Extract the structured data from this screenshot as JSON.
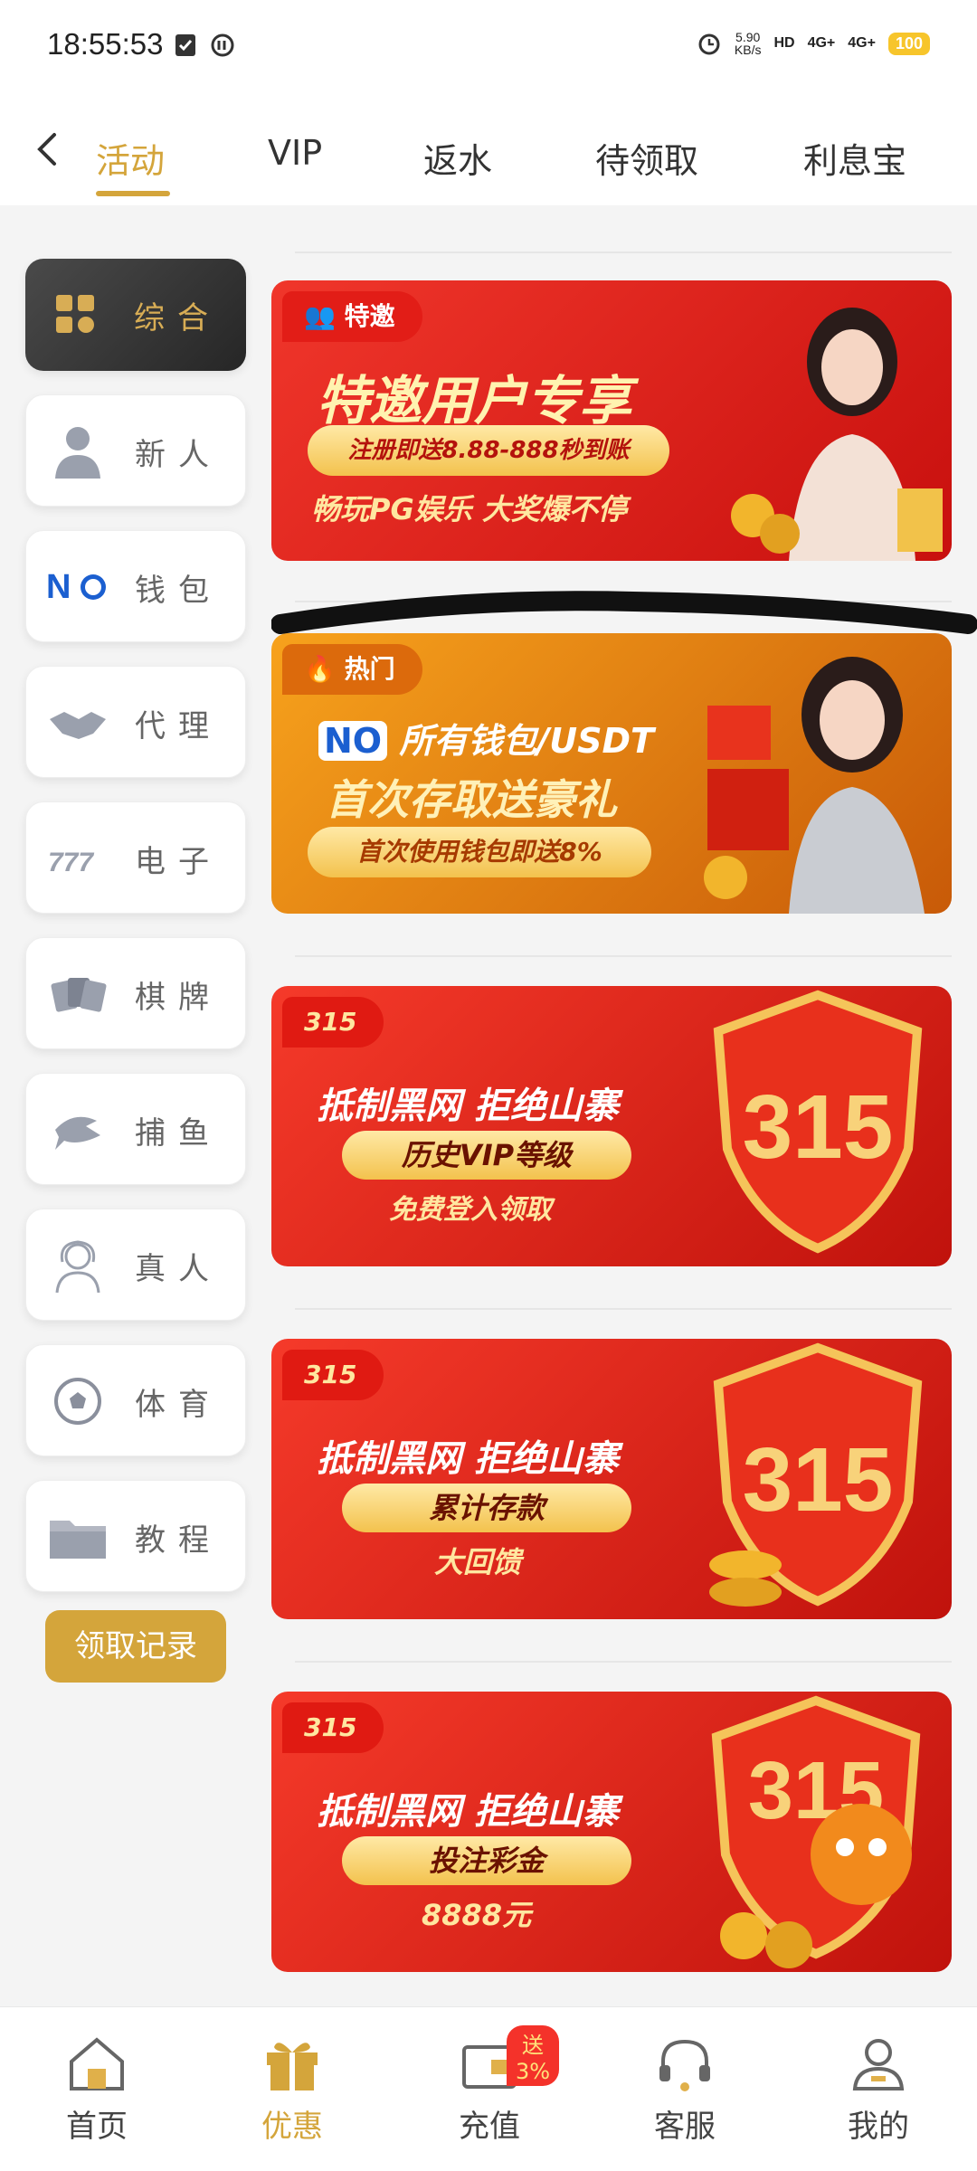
{
  "status_bar": {
    "time": "18:55:53",
    "speed_value": "5.90",
    "speed_unit": "KB/s",
    "hd_label": "HD",
    "signal1": "4G+",
    "signal2": "4G+",
    "battery": "100"
  },
  "top_nav": {
    "tabs": [
      {
        "label": "活动",
        "active": true
      },
      {
        "label": "VIP",
        "active": false
      },
      {
        "label": "返水",
        "active": false
      },
      {
        "label": "待领取",
        "active": false
      },
      {
        "label": "利息宝",
        "active": false
      }
    ]
  },
  "sidebar": {
    "items": [
      {
        "label": "综合",
        "icon": "grid-icon",
        "active": true
      },
      {
        "label": "新人",
        "icon": "person-icon",
        "active": false
      },
      {
        "label": "钱包",
        "icon": "no-wallet-icon",
        "active": false
      },
      {
        "label": "代理",
        "icon": "handshake-icon",
        "active": false
      },
      {
        "label": "电子",
        "icon": "slot-777-icon",
        "active": false
      },
      {
        "label": "棋牌",
        "icon": "cards-icon",
        "active": false
      },
      {
        "label": "捕鱼",
        "icon": "shark-icon",
        "active": false
      },
      {
        "label": "真人",
        "icon": "dealer-icon",
        "active": false
      },
      {
        "label": "体育",
        "icon": "soccer-ball-icon",
        "active": false
      },
      {
        "label": "教程",
        "icon": "folder-icon",
        "active": false
      }
    ],
    "records_button": "领取记录"
  },
  "banners": [
    {
      "tag": "特邀",
      "headline": "特邀用户专享",
      "pill": "注册即送8.88-888秒到账",
      "sub": "畅玩PG娱乐 大奖爆不停"
    },
    {
      "tag": "热门",
      "logo": "NO",
      "headline1": "所有钱包/USDT",
      "headline2": "首次存取送豪礼",
      "pill": "首次使用钱包即送8%"
    },
    {
      "tag": "315",
      "headline": "抵制黑网 拒绝山寨",
      "pill": "历史VIP等级",
      "sub": "免费登入领取",
      "shield": "315"
    },
    {
      "tag": "315",
      "headline": "抵制黑网 拒绝山寨",
      "pill": "累计存款",
      "sub": "大回馈",
      "shield": "315"
    },
    {
      "tag": "315",
      "headline": "抵制黑网 拒绝山寨",
      "pill": "投注彩金",
      "sub": "8888元",
      "shield": "315"
    }
  ],
  "bottom_nav": {
    "items": [
      {
        "label": "首页",
        "icon": "home-icon"
      },
      {
        "label": "优惠",
        "icon": "gift-icon",
        "active": true
      },
      {
        "label": "充值",
        "icon": "wallet-icon",
        "badge": "送3%"
      },
      {
        "label": "客服",
        "icon": "headset-icon"
      },
      {
        "label": "我的",
        "icon": "user-icon"
      }
    ]
  },
  "colors": {
    "accent_gold": "#d4a53b",
    "banner_red": "#e0201a",
    "banner_orange": "#e07a10"
  }
}
